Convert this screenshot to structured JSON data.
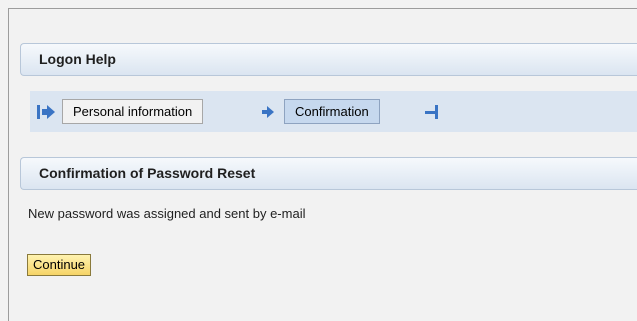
{
  "logon_help": {
    "title": "Logon Help"
  },
  "roadmap": {
    "steps": [
      {
        "label": "Personal information",
        "state": "completed"
      },
      {
        "label": "Confirmation",
        "state": "current"
      }
    ],
    "start_icon": "roadmap-start-icon",
    "separator_icon": "roadmap-arrow-icon",
    "end_icon": "roadmap-end-icon",
    "colors": {
      "icon": "#3a74c4",
      "bar": "#dbe5f1"
    }
  },
  "confirmation": {
    "title": "Confirmation of Password Reset",
    "message": "New password was assigned and sent by e-mail",
    "continue_label": "Continue"
  }
}
